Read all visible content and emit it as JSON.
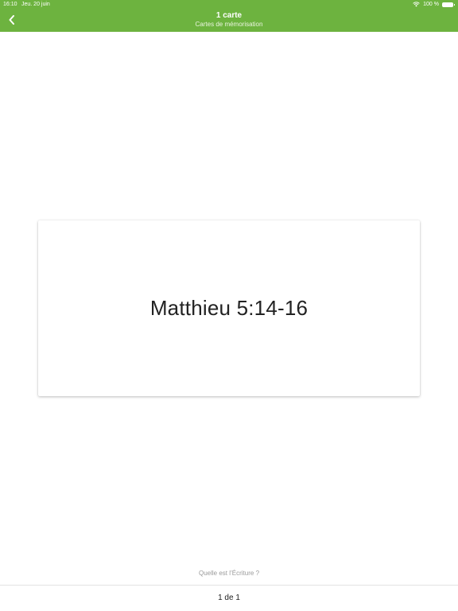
{
  "status_bar": {
    "time": "16:10",
    "date": "Jeu. 20 juin",
    "battery": "100 %"
  },
  "header": {
    "title": "1 carte",
    "subtitle": "Cartes de mémorisation"
  },
  "card": {
    "text": "Matthieu 5:14-16"
  },
  "footer": {
    "prompt": "Quelle est l’Écriture ?",
    "pager": "1 de 1"
  },
  "colors": {
    "accent": "#6db33f"
  },
  "icons": {
    "back": "chevron-left-icon",
    "wifi": "wifi-icon",
    "battery": "battery-icon"
  }
}
